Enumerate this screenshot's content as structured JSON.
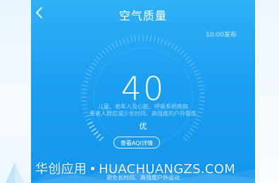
{
  "header": {
    "title": "空气质量",
    "publish_time": "10:00发布"
  },
  "aqi": {
    "value": "40",
    "level": "优",
    "detail_button": "查看AQI详情",
    "level_fraction": 0.08
  },
  "advice": {
    "line1": "儿童、老年人及心脏、呼吸系统疾病",
    "line2": "患者人群应减少长时间、高强度的户外锻炼",
    "line3": "避免长时间、高强度户外运动"
  },
  "watermark": {
    "brand": "华创应用",
    "separator": "•",
    "url": "HUACHUANGZS.COM"
  },
  "colors": {
    "sky_top": "#2fb0f7",
    "sky_bottom": "#1396ec",
    "text": "#ffffff"
  },
  "icons": {
    "back": "chevron-left-icon"
  }
}
